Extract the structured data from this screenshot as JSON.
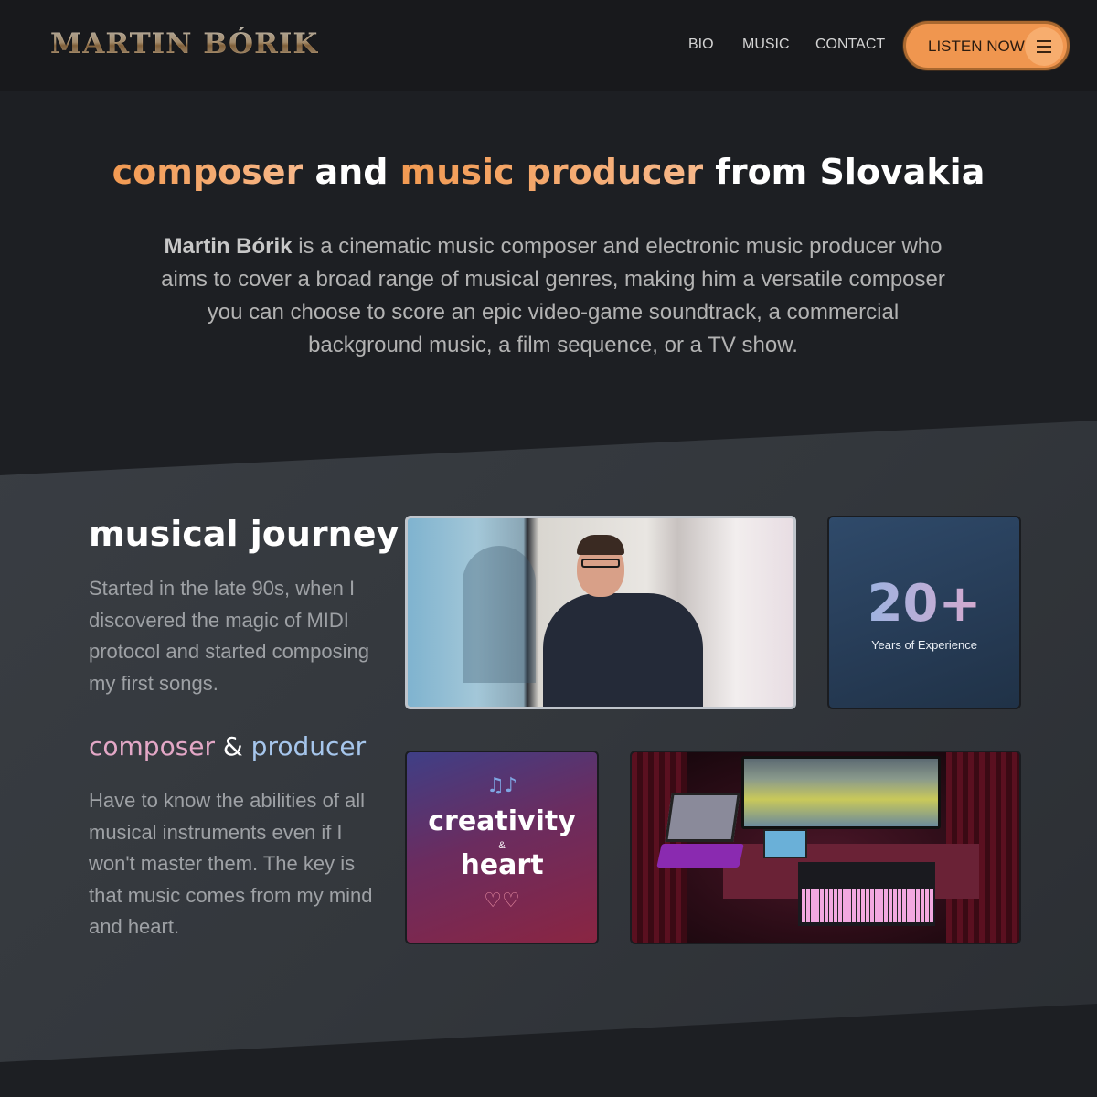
{
  "header": {
    "logo": "MARTIN BÓRIK",
    "nav": [
      "BIO",
      "MUSIC",
      "CONTACT"
    ],
    "cta_label": "LISTEN NOW",
    "cta_icon": "menu-icon",
    "accent_color": "#f0964f"
  },
  "hero": {
    "title_part1": "composer",
    "title_part2": " and ",
    "title_part3": "music producer",
    "title_part4": " from Slovakia",
    "intro_name": "Martin Bórik",
    "intro_text": " is a cinematic music composer and electronic music producer who aims to cover a broad range of musical genres, making him a versatile composer you can choose to score an epic video-game soundtrack, a commercial background music, a film sequence, or a TV show."
  },
  "journey": {
    "title": "musical journey",
    "text": "Started in the late 90s, when I discovered the magic of MIDI protocol and started composing my first songs.",
    "sub_part1": "composer",
    "sub_part2": " & ",
    "sub_part3": "producer",
    "sub_text": "Have to know the abilities of all musical instruments even if I won't master them. The key is that music comes from my mind and heart."
  },
  "cards": {
    "years_number": "20+",
    "years_label": "Years of Experience",
    "creativity_word": "creativity",
    "creativity_amp": "&",
    "heart_word": "heart",
    "notes_icon": "music-notes-icon",
    "hearts_icon": "hearts-icon"
  }
}
